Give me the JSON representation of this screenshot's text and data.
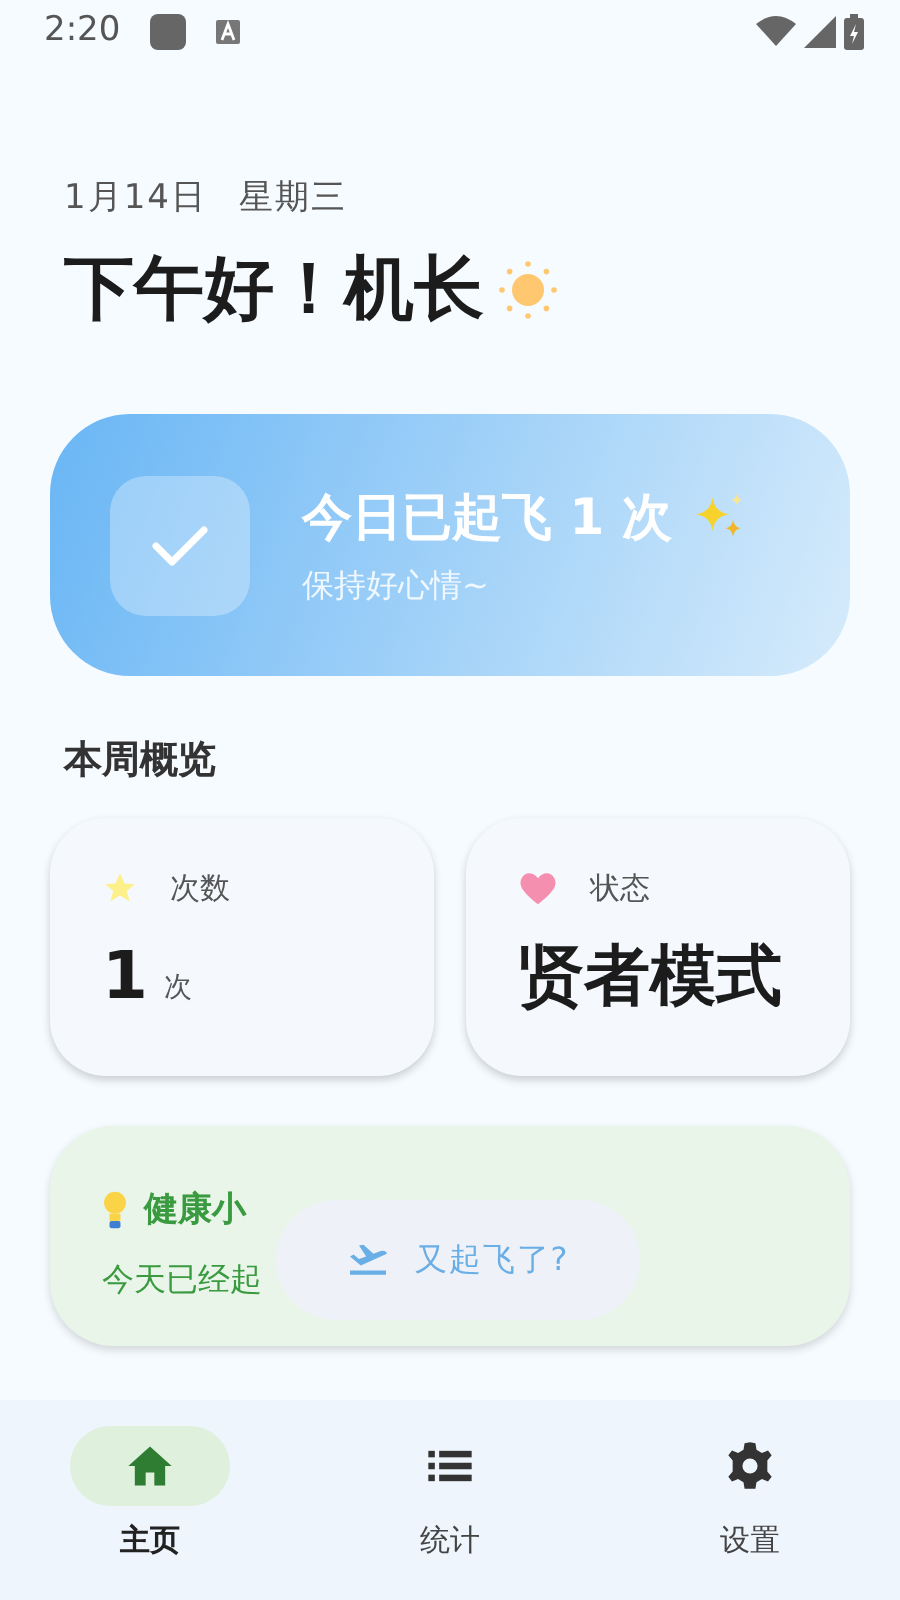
{
  "status_bar": {
    "time": "2:20"
  },
  "header": {
    "date": "1月14日",
    "weekday": "星期三",
    "greeting": "下午好！机长"
  },
  "hero": {
    "title": "今日已起飞 1 次",
    "subtitle": "保持好心情~"
  },
  "section_title": "本周概览",
  "stats": [
    {
      "kind": "count",
      "label": "次数",
      "value": "1",
      "unit": "次"
    },
    {
      "kind": "status",
      "label": "状态",
      "value": "贤者模式"
    }
  ],
  "tip": {
    "title": "健康小",
    "text": "今天已经起"
  },
  "toast": {
    "text": "又起飞了?"
  },
  "nav": [
    {
      "kind": "home",
      "label": "主页",
      "selected": true
    },
    {
      "kind": "list",
      "label": "统计",
      "selected": false
    },
    {
      "kind": "settings",
      "label": "设置",
      "selected": false
    }
  ]
}
